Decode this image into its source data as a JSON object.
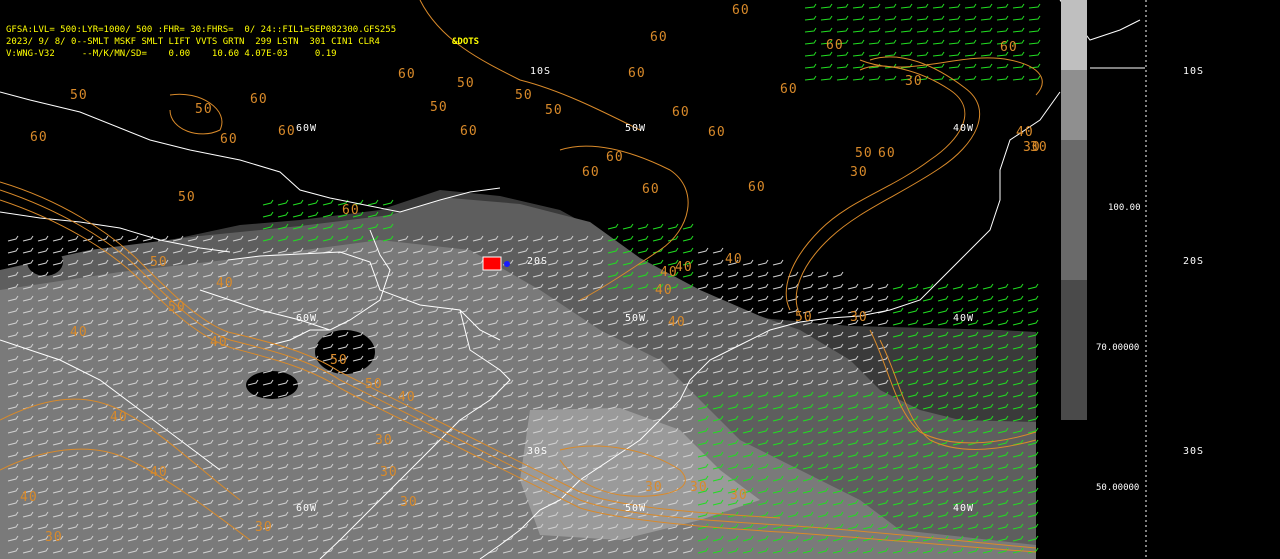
{
  "header": {
    "line1": "GFSA:LVL= 500:LYR=1000/ 500 :FHR= 30:FHRS=  0/ 24::FIL1=SEP082300.GFS255",
    "line2": "2023/ 9/ 8/ 0--SMLT MSKF SMLT LIFT VVTS GRTN  299 LSTN  301 CIN1 CLR4",
    "line3": "V:WNG-V32     --M/K/MN/SD=    0.00    10.60 4.07E-03     0.19",
    "dots_label": "&DOTS"
  },
  "map_labels": {
    "lon_60w_top": "60W",
    "lon_50w_top": "50W",
    "lon_40w_top": "40W",
    "lon_60w_mid": "60W",
    "lon_50w_mid": "50W",
    "lon_40w_mid": "40W",
    "lon_60w_bot": "60W",
    "lon_50w_bot": "50W",
    "lon_40w_bot": "40W",
    "lat_10s": "10S",
    "lat_20s": "20S",
    "lat_30s": "30S"
  },
  "contour_labels": [
    "60",
    "50",
    "40",
    "30"
  ],
  "colorbar": {
    "values": [
      "100.00",
      "70.00000",
      "50.00000"
    ],
    "shades": [
      "#9a9a9a",
      "#6e6e6e",
      "#4a4a4a",
      "#2e2e2e"
    ]
  },
  "side_labels": {
    "lat_10s": "10S",
    "lat_20s": "20S",
    "lat_30s": "30S"
  },
  "colors": {
    "background": "#000000",
    "coast": "#ffffff",
    "contour": "#d98a2a",
    "barbs_dry": "#d0d0d0",
    "barbs_green": "#22dd22",
    "shade_light": "#9b9b9b",
    "shade_mid": "#6f6f6f",
    "shade_dark": "#4d4d4d",
    "marker": "#ff0000",
    "marker_dot": "#1a1aff"
  }
}
